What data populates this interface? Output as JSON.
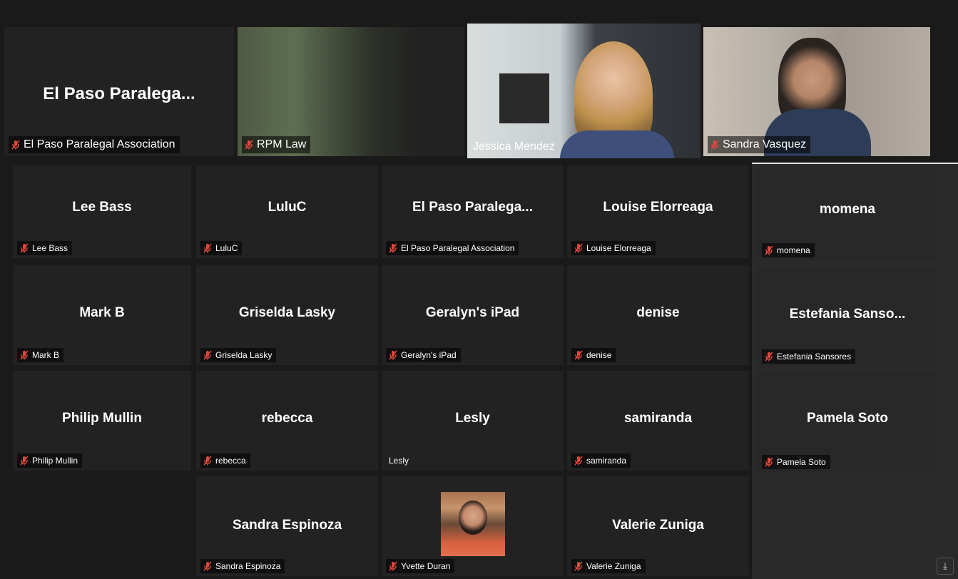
{
  "gallery": {
    "top_row": [
      {
        "big_name": "El Paso  Paralega...",
        "label": "El Paso Paralegal Association"
      },
      {
        "label": "RPM Law"
      },
      {
        "label": "Jessica Mendez"
      },
      {
        "label": "Sandra Vasquez"
      }
    ],
    "rows": [
      [
        {
          "big_name": "Lee Bass",
          "label": "Lee Bass"
        },
        {
          "big_name": "LuluC",
          "label": "LuluC"
        },
        {
          "big_name": "El Paso  Paralega...",
          "label": "El Paso Paralegal Association"
        },
        {
          "big_name": "Louise Elorreaga",
          "label": "Louise Elorreaga"
        },
        {
          "big_name": "momena",
          "label": "momena"
        }
      ],
      [
        {
          "big_name": "Mark B",
          "label": "Mark B"
        },
        {
          "big_name": "Griselda Lasky",
          "label": "Griselda Lasky"
        },
        {
          "big_name": "Geralyn's iPad",
          "label": "Geralyn's iPad"
        },
        {
          "big_name": "denise",
          "label": "denise"
        },
        {
          "big_name": "Estefania  Sanso...",
          "label": "Estefania Sansores"
        }
      ],
      [
        {
          "big_name": "Philip Mullin",
          "label": "Philip Mullin"
        },
        {
          "big_name": "rebecca",
          "label": "rebecca"
        },
        {
          "big_name": "Lesly",
          "label": "Lesly"
        },
        {
          "big_name": "samiranda",
          "label": "samiranda"
        },
        {
          "big_name": "Pamela Soto",
          "label": "Pamela Soto"
        }
      ],
      [
        {
          "big_name": "Sandra Espinoza",
          "label": "Sandra Espinoza"
        },
        {
          "label": "Yvette Duran"
        },
        {
          "big_name": "Valerie Zuniga",
          "label": "Valerie Zuniga"
        }
      ]
    ]
  },
  "colors": {
    "muted_mic": "#e0473b",
    "active_speaker_border": "#c8e06a",
    "tile_bg": "#222222"
  },
  "icons": {
    "muted": "microphone-muted-icon",
    "scroll": "download-arrow-icon"
  }
}
